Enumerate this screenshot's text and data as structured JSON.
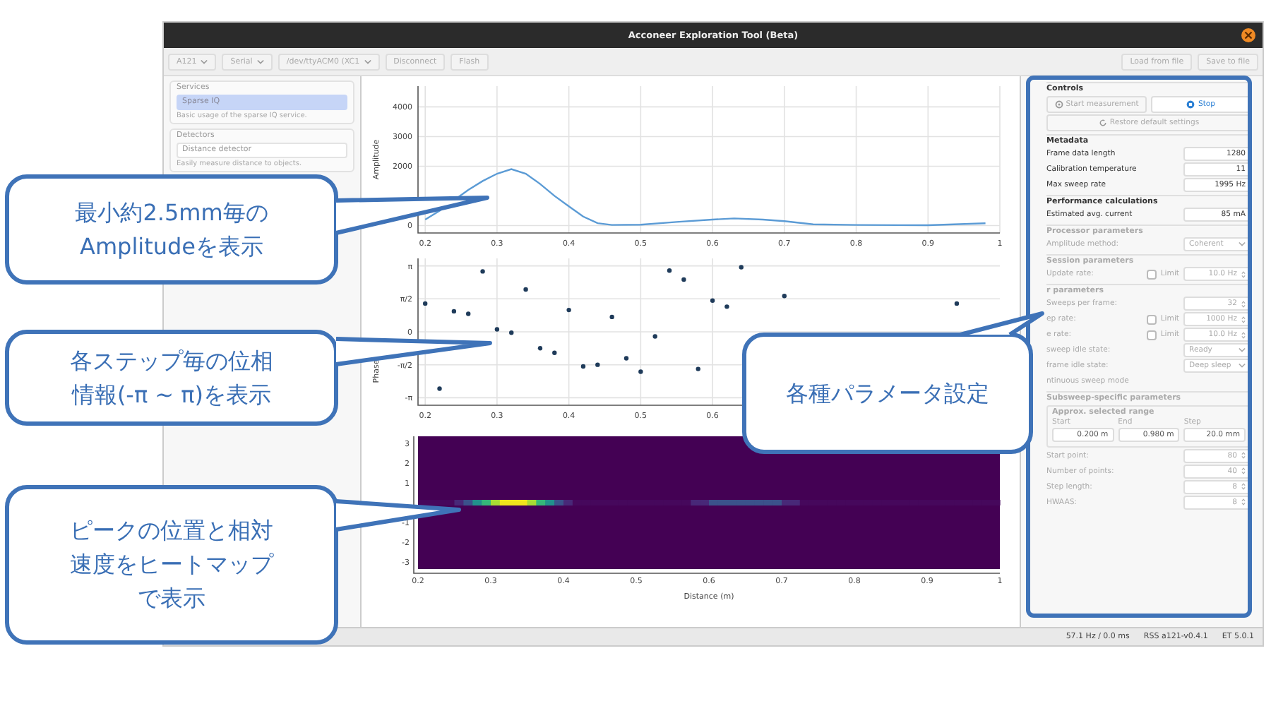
{
  "window": {
    "title": "Acconeer Exploration Tool (Beta)"
  },
  "toolbar": {
    "left": [
      {
        "kind": "dropdown",
        "label": "A121"
      },
      {
        "kind": "dropdown",
        "label": "Serial"
      },
      {
        "kind": "dropdown",
        "label": "/dev/ttyACM0 (XC1"
      },
      {
        "kind": "button",
        "label": "Disconnect"
      },
      {
        "kind": "button",
        "label": "Flash"
      }
    ],
    "right": [
      {
        "kind": "button",
        "label": "Load from file"
      },
      {
        "kind": "button",
        "label": "Save to file"
      }
    ]
  },
  "sidebar": {
    "groups": [
      {
        "title": "Services",
        "items": [
          {
            "label": "Sparse IQ",
            "selected": true,
            "description": "Basic usage of the sparse IQ service."
          }
        ]
      },
      {
        "title": "Detectors",
        "items": [
          {
            "label": "Distance detector",
            "selected": false,
            "description": "Easily measure distance to objects."
          }
        ]
      }
    ]
  },
  "plots": {
    "amplitude": {
      "chart_data": {
        "type": "line",
        "ylabel": "Amplitude",
        "grid": true,
        "x": [
          0.2,
          0.22,
          0.24,
          0.26,
          0.28,
          0.3,
          0.32,
          0.34,
          0.36,
          0.38,
          0.4,
          0.42,
          0.44,
          0.46,
          0.5,
          0.55,
          0.6,
          0.63,
          0.67,
          0.7,
          0.74,
          0.8,
          0.9,
          0.98
        ],
        "series": [
          {
            "color": "#5b9bd5",
            "values": [
              200,
              500,
              850,
              1200,
              1500,
              1750,
              1900,
              1750,
              1400,
              1000,
              650,
              300,
              80,
              20,
              30,
              120,
              200,
              240,
              200,
              150,
              40,
              20,
              10,
              80
            ]
          }
        ],
        "xlim": [
          0.19,
          1.0
        ],
        "ylim": [
          -250,
          4700
        ],
        "xticks": [
          {
            "value": 0.2,
            "label": "0.2"
          },
          {
            "value": 0.3,
            "label": "0.3"
          },
          {
            "value": 0.4,
            "label": "0.4"
          },
          {
            "value": 0.5,
            "label": "0.5"
          },
          {
            "value": 0.6,
            "label": "0.6"
          },
          {
            "value": 0.7,
            "label": "0.7"
          },
          {
            "value": 0.8,
            "label": "0.8"
          },
          {
            "value": 0.9,
            "label": "0.9"
          },
          {
            "value": 1,
            "label": "1"
          }
        ],
        "yticks": [
          0,
          2000,
          3000,
          4000
        ]
      }
    },
    "phase": {
      "chart_data": {
        "type": "scatter",
        "ylabel": "Phase",
        "grid": true,
        "x": [
          0.2,
          0.22,
          0.24,
          0.26,
          0.28,
          0.3,
          0.32,
          0.34,
          0.36,
          0.38,
          0.4,
          0.42,
          0.44,
          0.46,
          0.48,
          0.5,
          0.52,
          0.54,
          0.56,
          0.58,
          0.6,
          0.62,
          0.64,
          0.7,
          0.94
        ],
        "series": [
          {
            "color": "#1f3b5a",
            "values": [
              1.35,
              -2.71,
              0.98,
              0.86,
              2.88,
              0.12,
              -0.04,
              2.02,
              -0.78,
              -1.0,
              1.04,
              -1.65,
              -1.57,
              0.71,
              -1.26,
              -1.9,
              -0.22,
              2.92,
              2.49,
              -1.77,
              1.49,
              1.2,
              3.08,
              1.71,
              1.35
            ]
          }
        ],
        "xlim": [
          0.19,
          1.0
        ],
        "ylim": [
          -3.5,
          3.5
        ],
        "xticks": [
          {
            "value": 0.2,
            "label": "0.2"
          },
          {
            "value": 0.3,
            "label": "0.3"
          },
          {
            "value": 0.4,
            "label": "0.4"
          },
          {
            "value": 0.5,
            "label": "0.5"
          },
          {
            "value": 0.6,
            "label": "0.6"
          }
        ],
        "yticks": [
          {
            "value": 3.1416,
            "label": "π"
          },
          {
            "value": 1.5708,
            "label": "π/2"
          },
          {
            "value": 0,
            "label": "0"
          },
          {
            "value": -1.5708,
            "label": "-π/2"
          },
          {
            "value": -3.1416,
            "label": "-π"
          }
        ]
      }
    },
    "heatmap": {
      "xticks": [
        "0.2",
        "0.3",
        "0.4",
        "0.5",
        "0.6",
        "0.7",
        "0.8",
        "0.9",
        "1"
      ],
      "yticks": [
        "3",
        "2",
        "1",
        "-1",
        "-2",
        "-3"
      ],
      "xlabel": "Distance (m)"
    }
  },
  "panel": {
    "sections": [
      {
        "title": "Controls",
        "disabled": false,
        "rows": [
          {
            "kind": "buttons",
            "buttons": [
              {
                "kind": "start",
                "label": "Start measurement",
                "disabled": true
              },
              {
                "kind": "stop",
                "label": "Stop",
                "disabled": false
              }
            ]
          },
          {
            "kind": "buttons",
            "buttons": [
              {
                "kind": "restore",
                "label": "Restore default settings",
                "disabled": true
              }
            ]
          }
        ]
      },
      {
        "title": "Metadata",
        "disabled": false,
        "rows": [
          {
            "kind": "readout",
            "label": "Frame data length",
            "value": "1280"
          },
          {
            "kind": "readout",
            "label": "Calibration temperature",
            "value": "11"
          },
          {
            "kind": "readout",
            "label": "Max sweep rate",
            "value": "1995 Hz"
          }
        ]
      },
      {
        "title": "Performance calculations",
        "disabled": false,
        "rows": [
          {
            "kind": "readout",
            "label": "Estimated avg. current",
            "value": "85 mA"
          }
        ]
      },
      {
        "title": "Processor parameters",
        "disabled": true,
        "rows": [
          {
            "kind": "dropdown",
            "label": "Amplitude method:",
            "value": "Coherent"
          }
        ]
      },
      {
        "title": "Session parameters",
        "disabled": true,
        "rows": [
          {
            "kind": "limit",
            "label": "Update rate:",
            "checked": false,
            "option": "Limit",
            "value": "10.0 Hz"
          }
        ]
      },
      {
        "title": "r parameters",
        "disabled": true,
        "rows": [
          {
            "kind": "spin",
            "label": "Sweeps per frame:",
            "value": "32"
          },
          {
            "kind": "limit",
            "label": "ep rate:",
            "checked": false,
            "option": "Limit",
            "value": "1000 Hz"
          },
          {
            "kind": "limit",
            "label": "e rate:",
            "checked": false,
            "option": "Limit",
            "value": "10.0 Hz"
          },
          {
            "kind": "dropdown",
            "label": "sweep idle state:",
            "value": "Ready"
          },
          {
            "kind": "dropdown",
            "label": "frame idle state:",
            "value": "Deep sleep"
          },
          {
            "kind": "note",
            "label": "ntinuous sweep mode"
          }
        ]
      },
      {
        "title": "Subsweep-specific parameters",
        "disabled": true,
        "rows": [
          {
            "kind": "range",
            "title": "Approx. selected range",
            "fields": [
              {
                "label": "Start",
                "value": "0.200 m"
              },
              {
                "label": "End",
                "value": "0.980 m"
              },
              {
                "label": "Step",
                "value": "20.0 mm"
              }
            ]
          },
          {
            "kind": "spin",
            "label": "Start point:",
            "value": "80"
          },
          {
            "kind": "spin",
            "label": "Number of points:",
            "value": "40"
          },
          {
            "kind": "spin",
            "label": "Step length:",
            "value": "8"
          },
          {
            "kind": "spin",
            "label": "HWAAS:",
            "value": "8"
          }
        ]
      }
    ]
  },
  "status_bar": [
    "57.1 Hz / 0.0 ms",
    "RSS a121-v0.4.1",
    "ET 5.0.1"
  ],
  "callouts": [
    {
      "lines": [
        "最小約2.5mm毎の",
        "Amplitudeを表示"
      ]
    },
    {
      "lines": [
        "各ステップ毎の位相",
        "情報(-π ~ π)を表示"
      ]
    },
    {
      "lines": [
        "ピークの位置と相対",
        "速度をヒートマップ",
        "で表示"
      ]
    },
    {
      "lines": [
        "各種パラメータ設定"
      ]
    }
  ]
}
